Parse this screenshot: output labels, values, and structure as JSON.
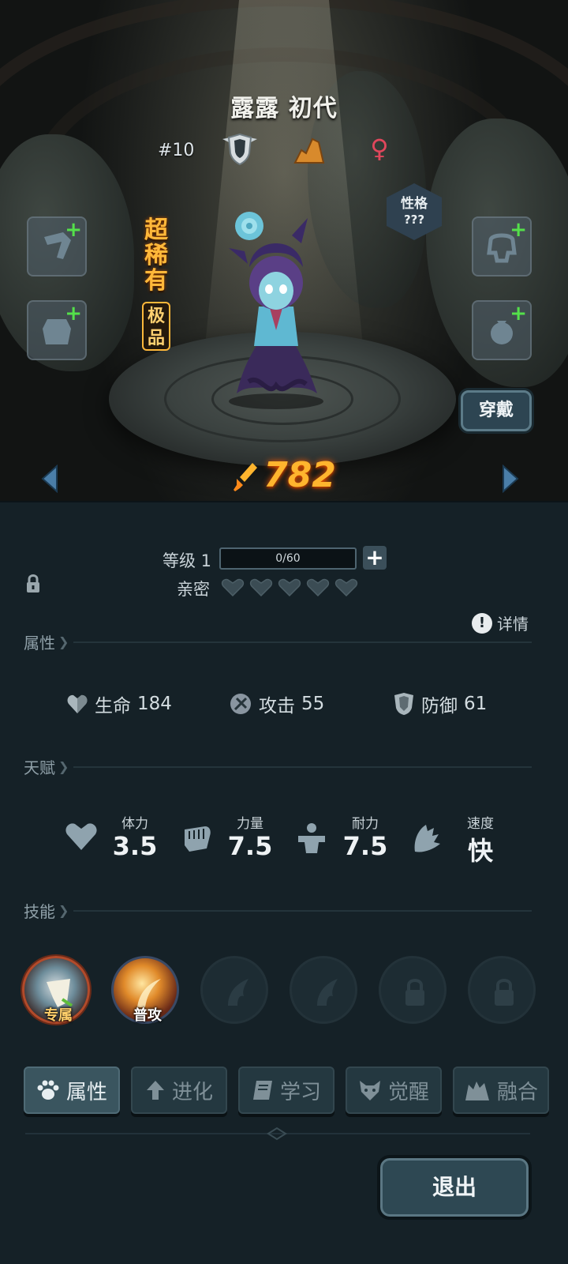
{
  "hero": {
    "name": "露露 初代",
    "number": "#10",
    "rarity": "超稀有",
    "grade": "极品",
    "personality_label": "性格",
    "personality_value": "???",
    "power": "782",
    "equip_label": "穿戴"
  },
  "level": {
    "label": "等级 1",
    "xp": "0/60",
    "intimacy_label": "亲密",
    "hearts": 5
  },
  "details_label": "详情",
  "sections": {
    "attributes": "属性",
    "talent": "天赋",
    "skills": "技能"
  },
  "stats": [
    {
      "label": "生命",
      "value": "184"
    },
    {
      "label": "攻击",
      "value": "55"
    },
    {
      "label": "防御",
      "value": "61"
    }
  ],
  "talents": [
    {
      "label": "体力",
      "value": "3.5"
    },
    {
      "label": "力量",
      "value": "7.5"
    },
    {
      "label": "耐力",
      "value": "7.5"
    },
    {
      "label": "速度",
      "value": "快"
    }
  ],
  "skills": [
    {
      "label": "专属",
      "state": "exclusive"
    },
    {
      "label": "普攻",
      "state": "normal"
    },
    {
      "label": "",
      "state": "empty"
    },
    {
      "label": "",
      "state": "empty"
    },
    {
      "label": "",
      "state": "locked"
    },
    {
      "label": "",
      "state": "locked"
    }
  ],
  "tabs": [
    {
      "label": "属性",
      "icon": "paw-icon",
      "active": true
    },
    {
      "label": "进化",
      "icon": "arrow-up-icon",
      "active": false
    },
    {
      "label": "学习",
      "icon": "book-icon",
      "active": false
    },
    {
      "label": "觉醒",
      "icon": "wolf-icon",
      "active": false
    },
    {
      "label": "融合",
      "icon": "fusion-icon",
      "active": false
    }
  ],
  "exit_label": "退出",
  "colors": {
    "power": "#ffb52e",
    "rarity": "#ffb83a",
    "slot_plus": "#54e04a",
    "gender": "#e0475c",
    "panel_bg": "#152127"
  }
}
